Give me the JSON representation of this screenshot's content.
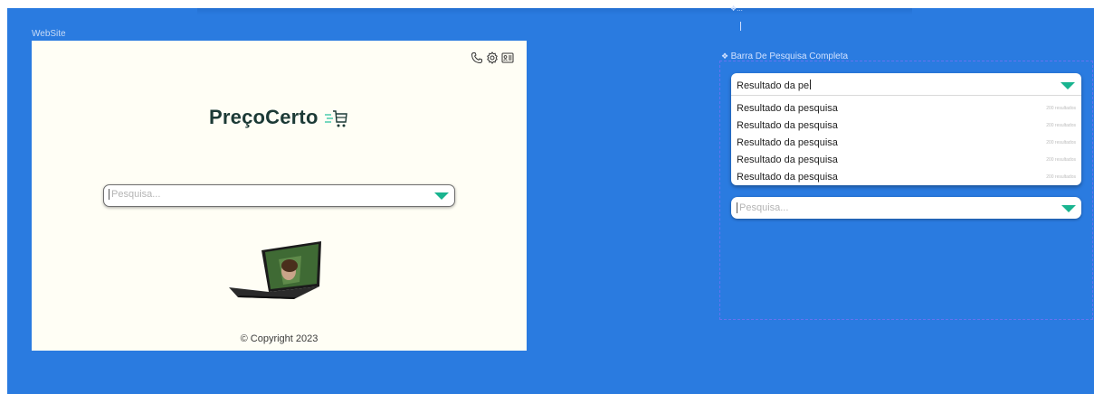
{
  "website": {
    "frame_label": "WebSite",
    "brand": "PreçoCerto",
    "search_placeholder": "Pesquisa...",
    "copyright": "© Copyright 2023",
    "header_icons": [
      "phone-icon",
      "gear-icon",
      "contact-card-icon"
    ]
  },
  "component": {
    "label": "Barra De Pesquisa Completa",
    "tiny_label": "❖...",
    "field_value": "Resultado da pe",
    "results": [
      {
        "text": "Resultado da pesquisa",
        "count": "200 resultados"
      },
      {
        "text": "Resultado da pesquisa",
        "count": "200 resultados"
      },
      {
        "text": "Resultado da pesquisa",
        "count": "200 resultados"
      },
      {
        "text": "Resultado da pesquisa",
        "count": "200 resultados"
      },
      {
        "text": "Resultado da pesquisa",
        "count": "200 resultados"
      }
    ],
    "search_placeholder": "Pesquisa..."
  },
  "colors": {
    "canvas": "#2a7be0",
    "accent": "#19b48f",
    "brand_text": "#1c3a36"
  }
}
